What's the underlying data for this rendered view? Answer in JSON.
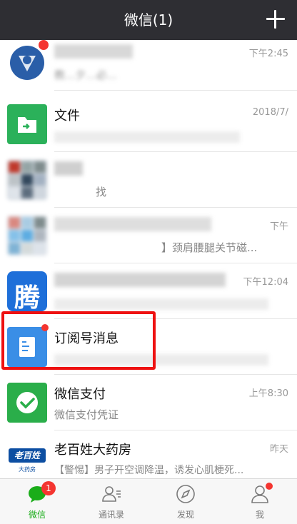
{
  "header": {
    "title": "微信(1)",
    "add_icon": "plus-icon"
  },
  "chats": [
    {
      "name": "",
      "preview": "教...夕...必...",
      "time": "下午2:45",
      "icon": "blue-shield-avatar"
    },
    {
      "name": "文件",
      "preview": "",
      "time": "2018/7/",
      "icon": "green-folder-icon"
    },
    {
      "name": "",
      "preview": "找",
      "time": "",
      "icon": "group-avatar"
    },
    {
      "name": "",
      "preview": "】颈肩腰腿关节磁...",
      "time": "下午",
      "icon": "group-avatar"
    },
    {
      "name": "",
      "preview": "",
      "time": "下午12:04",
      "icon": "peng-logo"
    },
    {
      "name": "订阅号消息",
      "preview": "",
      "time": "",
      "icon": "subscription-icon"
    },
    {
      "name": "微信支付",
      "preview": "微信支付凭证",
      "time": "上午8:30",
      "icon": "wechat-pay-icon"
    },
    {
      "name": "老百姓大药房",
      "preview": "【警惕】男子开空调降温，诱发心肌梗死...",
      "time": "昨天",
      "icon": "pharmacy-logo"
    }
  ],
  "logos": {
    "peng": "腾",
    "pharmacy": "老百姓",
    "pharmacy_sub": "大药房"
  },
  "tabs": [
    {
      "label": "微信",
      "icon": "chat-bubble-icon",
      "badge": "1"
    },
    {
      "label": "通讯录",
      "icon": "contacts-icon"
    },
    {
      "label": "发现",
      "icon": "compass-icon"
    },
    {
      "label": "我",
      "icon": "person-icon"
    }
  ],
  "colors": {
    "header_bg": "#2e2e33",
    "accent_green": "#1aad19",
    "badge_red": "#f43530",
    "highlight_red": "#ee1111"
  }
}
